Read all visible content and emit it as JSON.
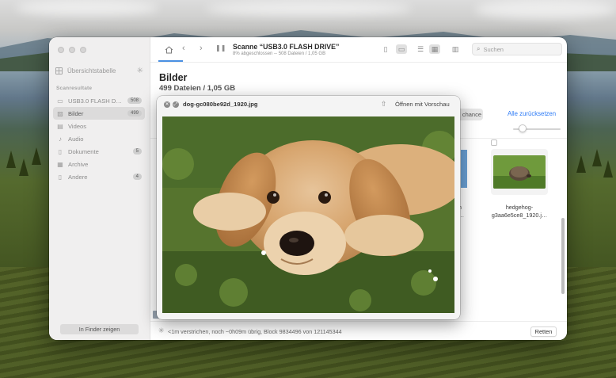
{
  "sidebar": {
    "overview": "Übersichtstabelle",
    "section": "Scanresultate",
    "items": [
      {
        "label": "USB3.0 FLASH DRI…",
        "badge": "508",
        "icon": "drive-icon"
      },
      {
        "label": "Bilder",
        "badge": "499",
        "icon": "image-icon",
        "active": true
      },
      {
        "label": "Videos",
        "badge": "",
        "icon": "video-icon"
      },
      {
        "label": "Audio",
        "badge": "",
        "icon": "music-note-icon"
      },
      {
        "label": "Dokumente",
        "badge": "5",
        "icon": "document-icon"
      },
      {
        "label": "Archive",
        "badge": "",
        "icon": "archive-icon"
      },
      {
        "label": "Andere",
        "badge": "4",
        "icon": "other-file-icon"
      }
    ],
    "finder_button": "In Finder zeigen"
  },
  "toolbar": {
    "title": "Scanne “USB3.0 FLASH DRIVE”",
    "subtitle": "8% abgeschlossen -- 508 Dateien / 1,05 GB",
    "search_placeholder": "Suchen"
  },
  "content": {
    "title": "Bilder",
    "subtitle": "499 Dateien / 1,05 GB",
    "chance_label": "chance",
    "reset_label": "Alle zurücksetzen",
    "tile_name_line1": "hedgehog-",
    "tile_name_line2": "g3aa6e5ce8_1920.j…",
    "fragment_1": "n",
    "fragment_2": "…"
  },
  "preview": {
    "filename": "dog-gc080be92d_1920.jpg",
    "open_with": "Öffnen mit Vorschau"
  },
  "statusbar": {
    "text": "<1m verstrichen, noch ~0h09m übrig, Block 9834496 von 121145344",
    "save_button": "Retten"
  },
  "colors": {
    "accent": "#2f7cf6",
    "selection": "#dcdbdb"
  }
}
